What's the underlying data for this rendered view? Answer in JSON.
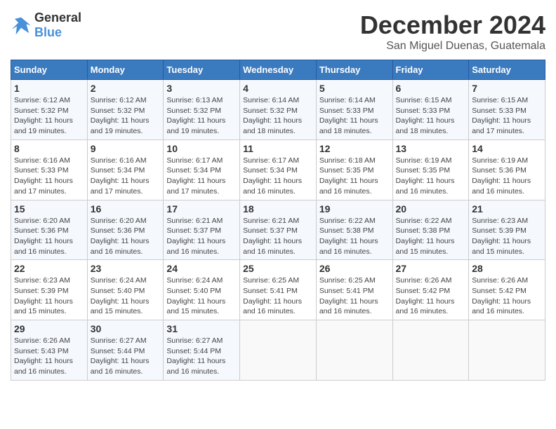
{
  "header": {
    "logo_general": "General",
    "logo_blue": "Blue",
    "month_title": "December 2024",
    "location": "San Miguel Duenas, Guatemala"
  },
  "days_of_week": [
    "Sunday",
    "Monday",
    "Tuesday",
    "Wednesday",
    "Thursday",
    "Friday",
    "Saturday"
  ],
  "weeks": [
    [
      {
        "day": 1,
        "sunrise": "6:12 AM",
        "sunset": "5:32 PM",
        "daylight": "11 hours and 19 minutes."
      },
      {
        "day": 2,
        "sunrise": "6:12 AM",
        "sunset": "5:32 PM",
        "daylight": "11 hours and 19 minutes."
      },
      {
        "day": 3,
        "sunrise": "6:13 AM",
        "sunset": "5:32 PM",
        "daylight": "11 hours and 19 minutes."
      },
      {
        "day": 4,
        "sunrise": "6:14 AM",
        "sunset": "5:32 PM",
        "daylight": "11 hours and 18 minutes."
      },
      {
        "day": 5,
        "sunrise": "6:14 AM",
        "sunset": "5:33 PM",
        "daylight": "11 hours and 18 minutes."
      },
      {
        "day": 6,
        "sunrise": "6:15 AM",
        "sunset": "5:33 PM",
        "daylight": "11 hours and 18 minutes."
      },
      {
        "day": 7,
        "sunrise": "6:15 AM",
        "sunset": "5:33 PM",
        "daylight": "11 hours and 17 minutes."
      }
    ],
    [
      {
        "day": 8,
        "sunrise": "6:16 AM",
        "sunset": "5:33 PM",
        "daylight": "11 hours and 17 minutes."
      },
      {
        "day": 9,
        "sunrise": "6:16 AM",
        "sunset": "5:34 PM",
        "daylight": "11 hours and 17 minutes."
      },
      {
        "day": 10,
        "sunrise": "6:17 AM",
        "sunset": "5:34 PM",
        "daylight": "11 hours and 17 minutes."
      },
      {
        "day": 11,
        "sunrise": "6:17 AM",
        "sunset": "5:34 PM",
        "daylight": "11 hours and 16 minutes."
      },
      {
        "day": 12,
        "sunrise": "6:18 AM",
        "sunset": "5:35 PM",
        "daylight": "11 hours and 16 minutes."
      },
      {
        "day": 13,
        "sunrise": "6:19 AM",
        "sunset": "5:35 PM",
        "daylight": "11 hours and 16 minutes."
      },
      {
        "day": 14,
        "sunrise": "6:19 AM",
        "sunset": "5:36 PM",
        "daylight": "11 hours and 16 minutes."
      }
    ],
    [
      {
        "day": 15,
        "sunrise": "6:20 AM",
        "sunset": "5:36 PM",
        "daylight": "11 hours and 16 minutes."
      },
      {
        "day": 16,
        "sunrise": "6:20 AM",
        "sunset": "5:36 PM",
        "daylight": "11 hours and 16 minutes."
      },
      {
        "day": 17,
        "sunrise": "6:21 AM",
        "sunset": "5:37 PM",
        "daylight": "11 hours and 16 minutes."
      },
      {
        "day": 18,
        "sunrise": "6:21 AM",
        "sunset": "5:37 PM",
        "daylight": "11 hours and 16 minutes."
      },
      {
        "day": 19,
        "sunrise": "6:22 AM",
        "sunset": "5:38 PM",
        "daylight": "11 hours and 16 minutes."
      },
      {
        "day": 20,
        "sunrise": "6:22 AM",
        "sunset": "5:38 PM",
        "daylight": "11 hours and 15 minutes."
      },
      {
        "day": 21,
        "sunrise": "6:23 AM",
        "sunset": "5:39 PM",
        "daylight": "11 hours and 15 minutes."
      }
    ],
    [
      {
        "day": 22,
        "sunrise": "6:23 AM",
        "sunset": "5:39 PM",
        "daylight": "11 hours and 15 minutes."
      },
      {
        "day": 23,
        "sunrise": "6:24 AM",
        "sunset": "5:40 PM",
        "daylight": "11 hours and 15 minutes."
      },
      {
        "day": 24,
        "sunrise": "6:24 AM",
        "sunset": "5:40 PM",
        "daylight": "11 hours and 15 minutes."
      },
      {
        "day": 25,
        "sunrise": "6:25 AM",
        "sunset": "5:41 PM",
        "daylight": "11 hours and 16 minutes."
      },
      {
        "day": 26,
        "sunrise": "6:25 AM",
        "sunset": "5:41 PM",
        "daylight": "11 hours and 16 minutes."
      },
      {
        "day": 27,
        "sunrise": "6:26 AM",
        "sunset": "5:42 PM",
        "daylight": "11 hours and 16 minutes."
      },
      {
        "day": 28,
        "sunrise": "6:26 AM",
        "sunset": "5:42 PM",
        "daylight": "11 hours and 16 minutes."
      }
    ],
    [
      {
        "day": 29,
        "sunrise": "6:26 AM",
        "sunset": "5:43 PM",
        "daylight": "11 hours and 16 minutes."
      },
      {
        "day": 30,
        "sunrise": "6:27 AM",
        "sunset": "5:44 PM",
        "daylight": "11 hours and 16 minutes."
      },
      {
        "day": 31,
        "sunrise": "6:27 AM",
        "sunset": "5:44 PM",
        "daylight": "11 hours and 16 minutes."
      },
      null,
      null,
      null,
      null
    ]
  ]
}
